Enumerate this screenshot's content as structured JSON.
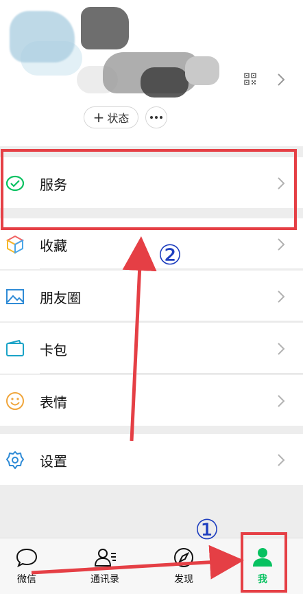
{
  "profile": {
    "status_label": "状态",
    "status_plus": "+"
  },
  "menu": {
    "services": "服务",
    "favorites": "收藏",
    "moments": "朋友圈",
    "cards": "卡包",
    "stickers": "表情",
    "settings": "设置"
  },
  "tabbar": {
    "chats": "微信",
    "contacts": "通讯录",
    "discover": "发现",
    "me": "我"
  },
  "annotations": {
    "step1": "①",
    "step2": "②"
  },
  "colors": {
    "wechat_green": "#07c160",
    "annotation_red": "#e53f45",
    "annotation_blue": "#1f3fbf"
  }
}
